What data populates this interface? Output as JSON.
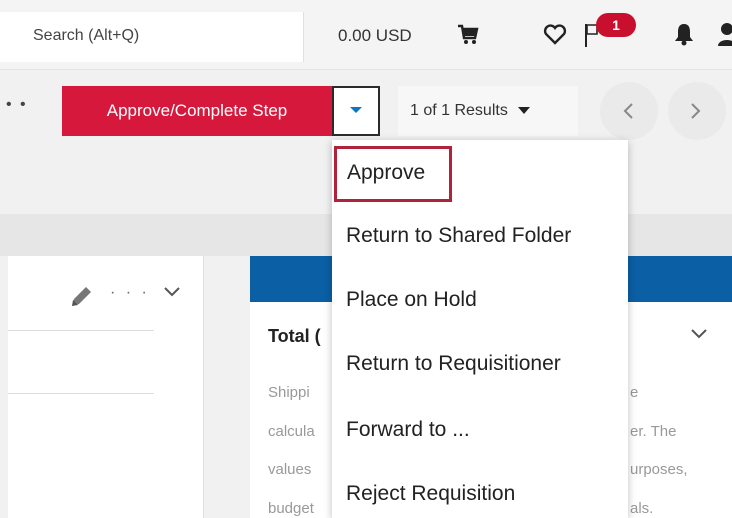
{
  "header": {
    "search_placeholder": "Search (Alt+Q)",
    "cart_total": "0.00 USD",
    "notification_count": "1"
  },
  "actions": {
    "primary_label": "Approve/Complete Step",
    "results_label": "1 of 1 Results"
  },
  "dropdown": {
    "items": [
      "Approve",
      "Return to Shared Folder",
      "Place on Hold",
      "Return to Requisitioner",
      "Forward to ...",
      "Reject Requisition"
    ]
  },
  "summary_card": {
    "title_partial": "Total (",
    "left_fragments": [
      "Shippi",
      "calcula",
      "values",
      "budget"
    ],
    "right_fragments": [
      "e",
      "er. The",
      "urposes,",
      "als."
    ]
  },
  "colors": {
    "brand_red": "#d6183c",
    "header_blue": "#0b5fa5",
    "focus_outline": "#b0243b"
  },
  "icons": [
    "cart-icon",
    "heart-icon",
    "flag-icon",
    "bell-icon",
    "user-icon",
    "chevron-down-icon",
    "chevron-left-icon",
    "chevron-right-icon",
    "pencil-icon",
    "more-icon"
  ]
}
